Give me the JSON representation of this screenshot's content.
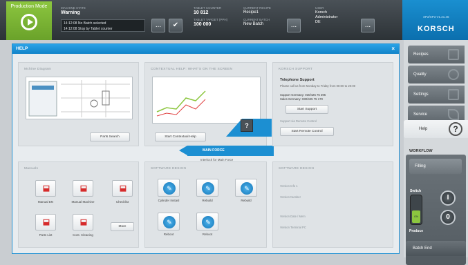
{
  "topbar": {
    "mode_label": "Production Mode",
    "status_key": "MACHINE STATE",
    "status_value": "Warning",
    "messages": [
      "14:12:08 No Batch selected",
      "14:12:08 Stop by Tablet counter"
    ],
    "product_key": "TABLET COUNTER",
    "product_value": "10 812",
    "target_key": "TABLET TARGET (PPH)",
    "target_value": "100 000",
    "recipe_key": "CURRENT RECIPE",
    "recipe_value": "Recipe1",
    "batch_key": "CURRENT BATCH",
    "batch_value": "New Batch",
    "user_key": "USER",
    "user_values": [
      "Korsch",
      "Administrator",
      "DE"
    ],
    "dots_label": "...",
    "check_label": "✔"
  },
  "brand": {
    "version": "XP2/XP3 V1.21.46",
    "logo": "KORSCH",
    "accent": "#1c8fd2"
  },
  "help": {
    "title": "HELP",
    "close": "×",
    "cards": {
      "machine_diagram": {
        "title": "Mchine Diagram",
        "button": "Parts Search"
      },
      "contextual": {
        "title": "CONTEXTUAL HELP: WHAT'S ON THE SCREEN",
        "main_force": "MAIN FORCE",
        "sub_force": "Interlock for Main Force",
        "button": "Start Contextual Help"
      },
      "support": {
        "title": "KORSCH SUPPORT",
        "heading": "Telephone Support",
        "lines": [
          "Please call us from Monday to Friday from 08:00 to 20:00",
          "Support Germany: 030/425 75 396",
          "Sales Germany: 030/425 75 170"
        ],
        "button1": "Start Support",
        "remote_caption": "Support via Remote Control",
        "button2": "Start Remote Control"
      },
      "manuals": {
        "title": "Manuals",
        "items": [
          "Manual EN",
          "Manual Machine",
          "Checklist",
          "Parts List",
          "Cont. Cleaning",
          "More"
        ]
      },
      "software_design": {
        "title": "SOFTWARE DESIGN",
        "items": [
          "Cylinder Instasl",
          "Rebuild",
          "Rebuild",
          "Reboot",
          "Reboot"
        ]
      },
      "software_info": {
        "title": "SOFTWARE DESIGN",
        "lines": [
          "Version Info 1",
          "Version Number",
          "Version Date / Mem",
          "Version Terminal PC"
        ]
      }
    }
  },
  "rail": {
    "nav": [
      "Recipes",
      "Quality",
      "Settings",
      "Service",
      "Help"
    ],
    "active": "Help",
    "workflow_title": "WORKFLOW",
    "fill_label": "Filling",
    "switch_label": "Switch",
    "switch_state": "ON",
    "btn_i": "I",
    "btn_o": "0",
    "production_label": "Produce",
    "batch_end": "Batch End"
  }
}
